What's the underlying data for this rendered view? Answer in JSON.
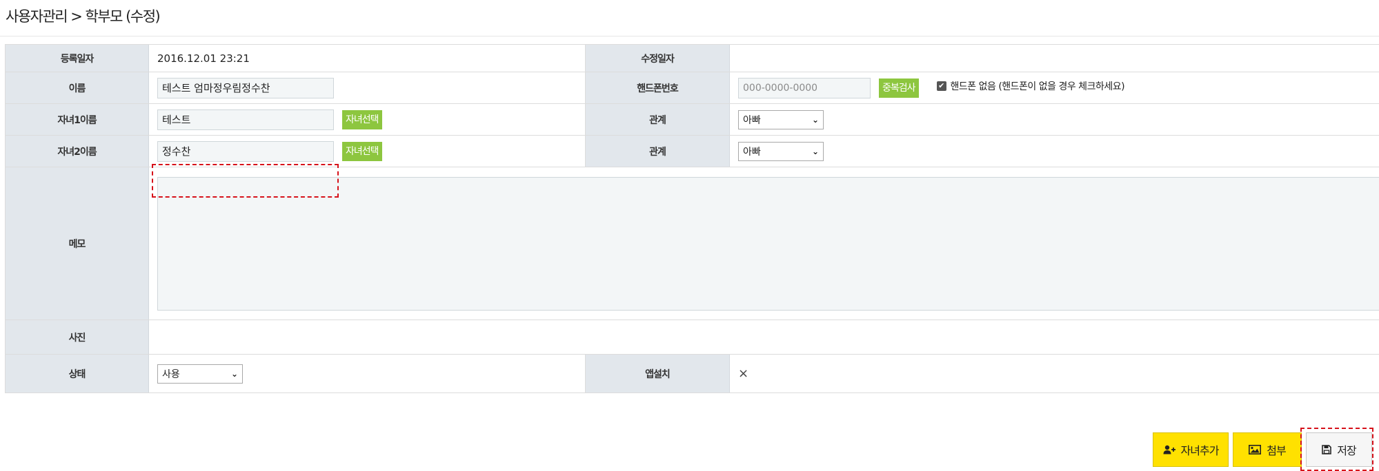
{
  "page": {
    "breadcrumb": "사용자관리 > 학부모 (수정)"
  },
  "form": {
    "reg_date_label": "등록일자",
    "reg_date_value": "2016.12.01 23:21",
    "mod_date_label": "수정일자",
    "mod_date_value": "",
    "name_label": "이름",
    "name_value": "테스트 엄마정우림정수찬",
    "phone_label": "핸드폰번호",
    "phone_placeholder": "000-0000-0000",
    "dup_check_label": "중복검사",
    "no_phone_label": "핸드폰 없음 (핸드폰이 없을 경우 체크하세요)",
    "no_phone_checked": true,
    "child1_label": "자녀1이름",
    "child1_value": "테스트",
    "child_select_label": "자녀선택",
    "relation_label": "관계",
    "relation1_value": "아빠",
    "child2_label": "자녀2이름",
    "child2_value": "정수찬",
    "relation2_value": "아빠",
    "memo_label": "메모",
    "memo_value": "",
    "photo_label": "사진",
    "status_label": "상태",
    "status_value": "사용",
    "app_label": "앱설치",
    "app_value": "×"
  },
  "actions": {
    "add_child": "자녀추가",
    "attach": "첨부",
    "save": "저장"
  },
  "colors": {
    "header_bg": "#e2e7ec",
    "green_button": "#8dc63f",
    "yellow_button": "#ffe100",
    "highlight_dash": "#d6111a"
  }
}
